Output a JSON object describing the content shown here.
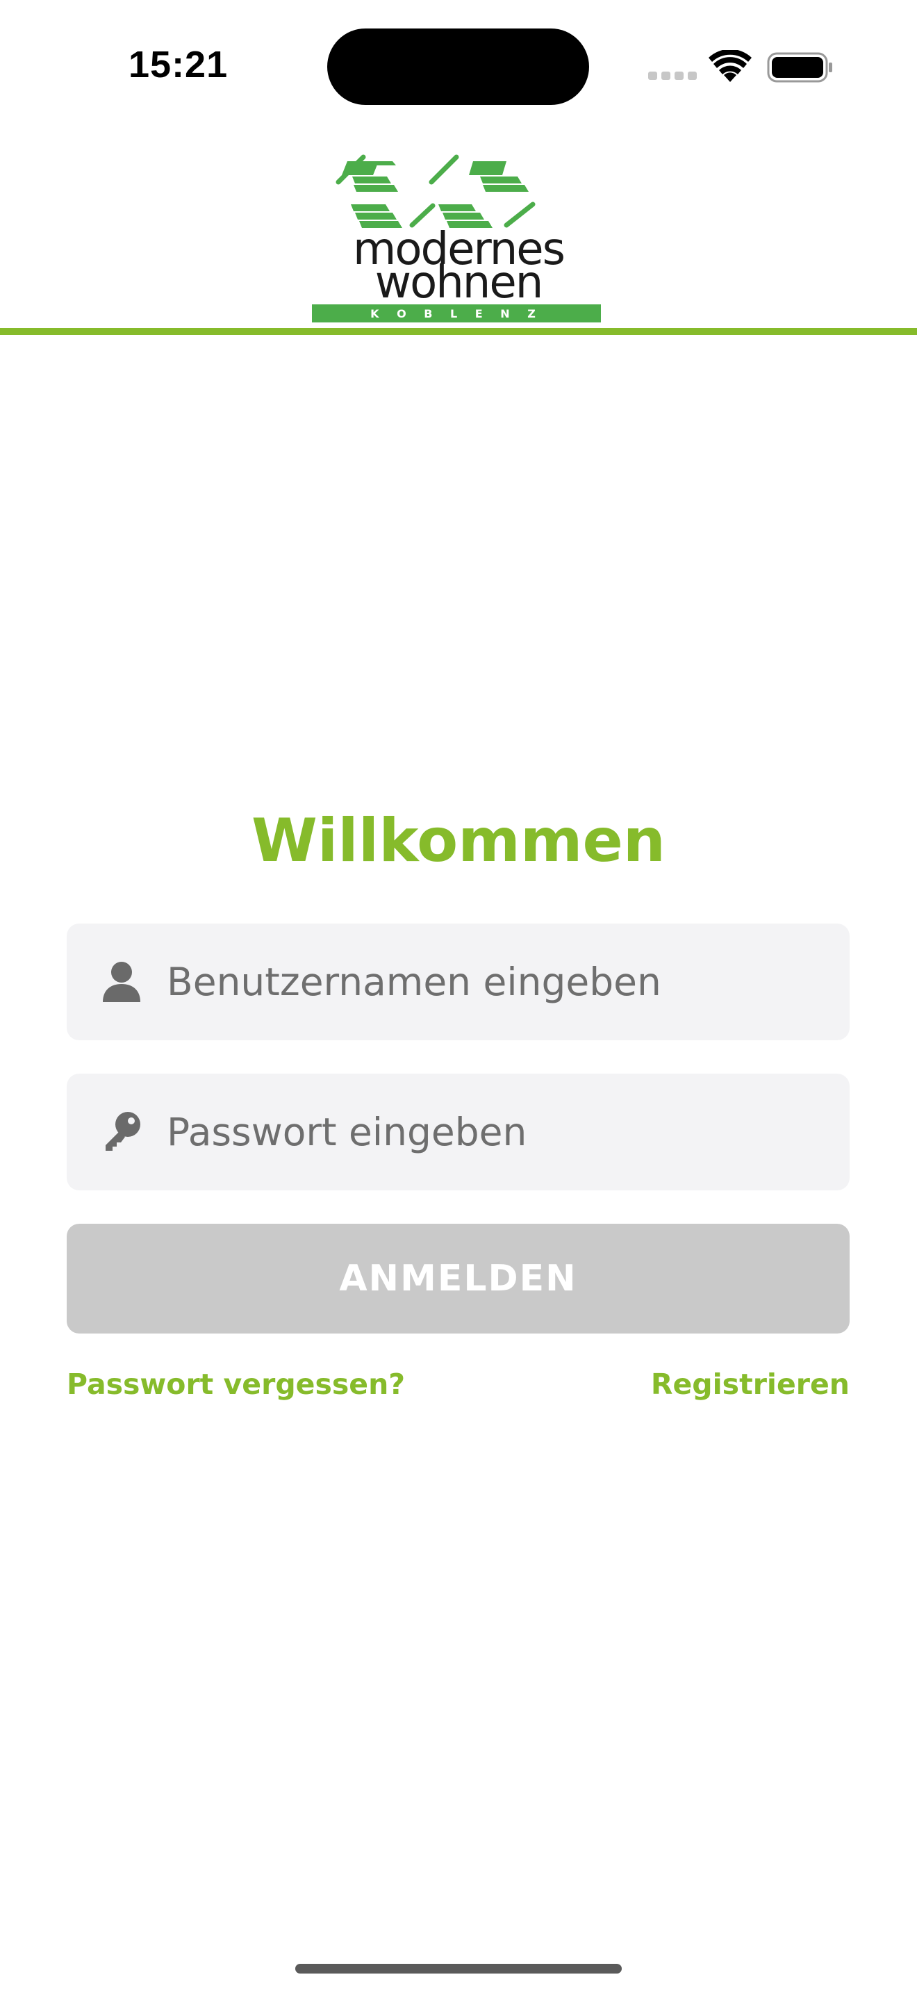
{
  "status_bar": {
    "time": "15:21",
    "icons": [
      "cellular-signal-icon",
      "wifi-icon",
      "battery-icon"
    ]
  },
  "header": {
    "logo": {
      "line1": "modernes",
      "line2": "wohnen",
      "tagline": "K O B L E N Z"
    }
  },
  "login": {
    "title": "Willkommen",
    "username": {
      "placeholder": "Benutzernamen eingeben",
      "value": "",
      "icon": "user-icon"
    },
    "password": {
      "placeholder": "Passwort eingeben",
      "value": "",
      "icon": "key-icon"
    },
    "submit_label": "ANMELDEN",
    "forgot_password_label": "Passwort vergessen?",
    "register_label": "Registrieren"
  },
  "colors": {
    "accent": "#86bb2b",
    "logo_green": "#4cad4a",
    "input_background": "#f3f3f5",
    "button_disabled": "#c9c9c9",
    "placeholder_text": "#6e6e6e"
  }
}
